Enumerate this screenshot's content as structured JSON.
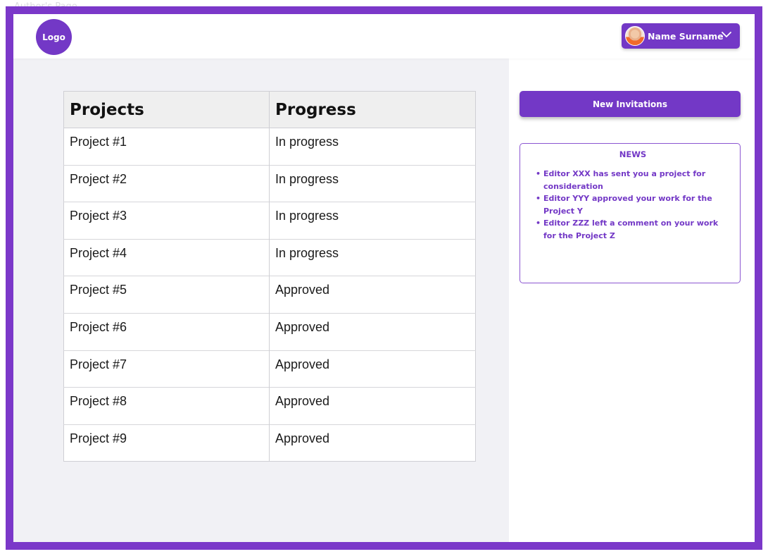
{
  "page": {
    "frame_label": "Author's Page"
  },
  "header": {
    "logo_text": "Logo",
    "user_name": "Name Surname",
    "avatar": "user-avatar",
    "dropdown_icon": "chevron-down-icon"
  },
  "table": {
    "headers": [
      "Projects",
      "Progress"
    ],
    "rows": [
      [
        "Project #1",
        "In progress"
      ],
      [
        "Project #2",
        "In progress"
      ],
      [
        "Project #3",
        "In progress"
      ],
      [
        "Project #4",
        "In progress"
      ],
      [
        "Project #5",
        "Approved"
      ],
      [
        "Project #6",
        "Approved"
      ],
      [
        "Project #7",
        "Approved"
      ],
      [
        "Project #8",
        "Approved"
      ],
      [
        "Project #9",
        "Approved"
      ]
    ]
  },
  "sidebar": {
    "invite_button": "New Invitations",
    "news": {
      "title": "NEWS",
      "items": [
        "Editor XXX has sent you a project for consideration",
        "Editor YYY approved your work for the Project Y",
        "Editor ZZZ left a comment on your work for the Project Z"
      ]
    }
  },
  "colors": {
    "accent": "#7338c6",
    "frame": "#7b38c9",
    "main_bg": "#f1f1f5"
  }
}
